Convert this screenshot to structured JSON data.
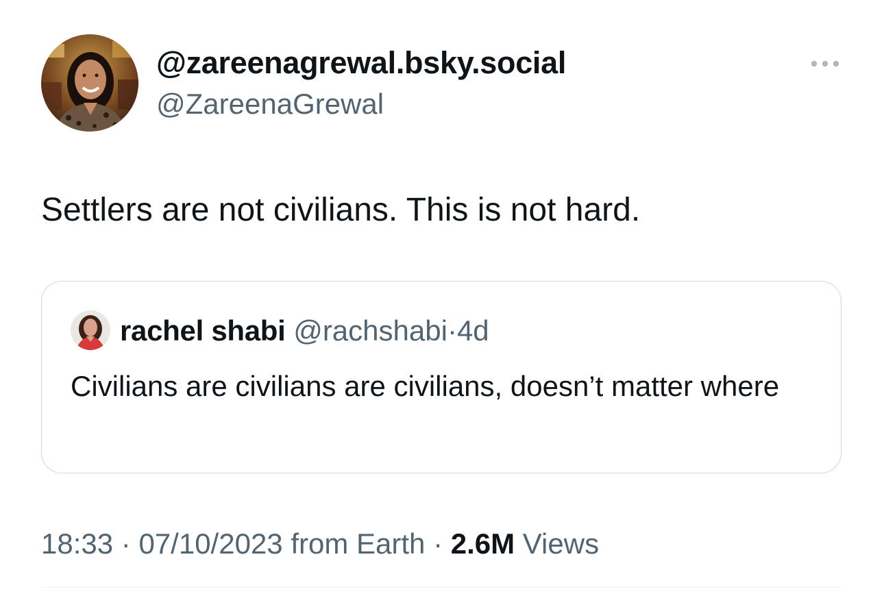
{
  "tweet": {
    "author": {
      "display_name": "@zareenagrewal.bsky.social",
      "handle": "@ZareenaGrewal"
    },
    "text": "Settlers are not civilians. This is not hard.",
    "more_icon": "more-horizontal-icon"
  },
  "quoted_tweet": {
    "author_name": "rachel shabi",
    "author_handle": "@rachshabi",
    "separator": "·",
    "age": "4d",
    "text": "Civilians are civilians are civilians, doesn’t matter where"
  },
  "meta": {
    "time": "18:33",
    "separator": "·",
    "date": "07/10/2023",
    "source": "from Earth",
    "views_count": "2.6M",
    "views_label": "Views"
  },
  "colors": {
    "text_primary": "#0f1419",
    "text_secondary": "#536471",
    "border": "#cfd9de",
    "divider": "#eff3f4"
  }
}
